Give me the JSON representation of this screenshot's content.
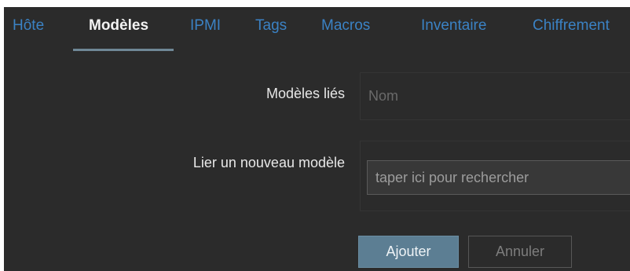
{
  "tabs": [
    {
      "label": "Hôte",
      "active": false
    },
    {
      "label": "Modèles",
      "active": true
    },
    {
      "label": "IPMI",
      "active": false
    },
    {
      "label": "Tags",
      "active": false
    },
    {
      "label": "Macros",
      "active": false
    },
    {
      "label": "Inventaire",
      "active": false
    },
    {
      "label": "Chiffrement",
      "active": false
    }
  ],
  "linked_templates": {
    "label": "Modèles liés",
    "column_header": "Nom"
  },
  "link_new": {
    "label": "Lier un nouveau modèle",
    "input_value": "",
    "input_placeholder": "taper ici pour rechercher"
  },
  "buttons": {
    "add": "Ajouter",
    "cancel": "Annuler"
  },
  "colors": {
    "background": "#2b2b2b",
    "tab_link": "#3b82c4",
    "tab_active": "#f2f2f2",
    "primary_button": "#5c7e93"
  }
}
